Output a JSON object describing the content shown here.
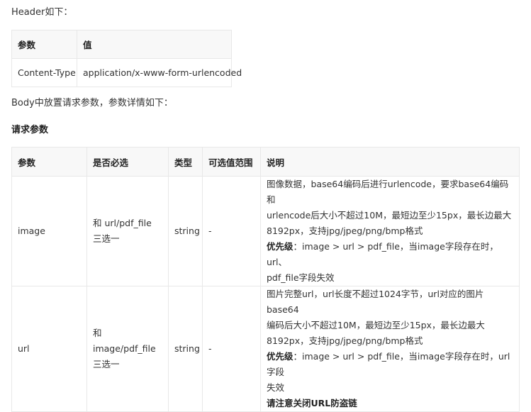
{
  "header_section": {
    "intro": "Header如下：",
    "table": {
      "columns": [
        "参数",
        "值"
      ],
      "rows": [
        [
          "Content-Type",
          "application/x-www-form-urlencoded"
        ]
      ]
    }
  },
  "body_section": {
    "intro": "Body中放置请求参数，参数详情如下：",
    "title": "请求参数",
    "table": {
      "columns": [
        "参数",
        "是否必选",
        "类型",
        "可选值范围",
        "说明"
      ],
      "rows": [
        {
          "param": "image",
          "required": "和 url/pdf_file 三选一",
          "type": "string",
          "range": "-",
          "desc_lines": [
            "图像数据，base64编码后进行urlencode，要求base64编码和",
            "urlencode后大小不超过10M，最短边至少15px，最长边最大",
            "8192px，支持jpg/jpeg/png/bmp格式"
          ],
          "priority_label": "优先级",
          "priority_lines": [
            "：image > url > pdf_file，当image字段存在时，url、",
            "pdf_file字段失效"
          ]
        },
        {
          "param": "url",
          "required": "和 image/pdf_file 三选一",
          "type": "string",
          "range": "-",
          "desc_lines": [
            "图片完整url，url长度不超过1024字节，url对应的图片base64",
            "编码后大小不超过10M，最短边至少15px，最长边最大",
            "8192px，支持jpg/jpeg/png/bmp格式"
          ],
          "priority_label": "优先级",
          "priority_lines": [
            "：image > url > pdf_file，当image字段存在时，url字段",
            "失效"
          ],
          "note": "请注意关闭URL防盗链"
        }
      ]
    }
  }
}
